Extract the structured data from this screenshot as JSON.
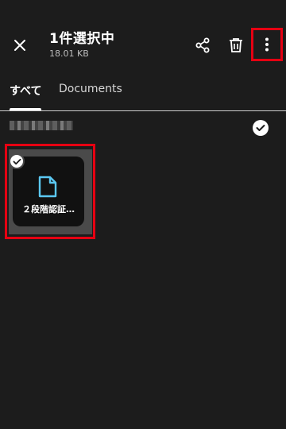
{
  "header": {
    "title": "1件選択中",
    "subtitle": "18.01 KB"
  },
  "tabs": [
    {
      "label": "すべて",
      "active": true
    },
    {
      "label": "Documents",
      "active": false
    }
  ],
  "group": {
    "selected": true
  },
  "file": {
    "name": "２段階認証…",
    "selected": true,
    "icon": "document-icon",
    "icon_color": "#5bc8f2"
  },
  "colors": {
    "highlight": "#e60012",
    "background": "#1c1c1c"
  }
}
